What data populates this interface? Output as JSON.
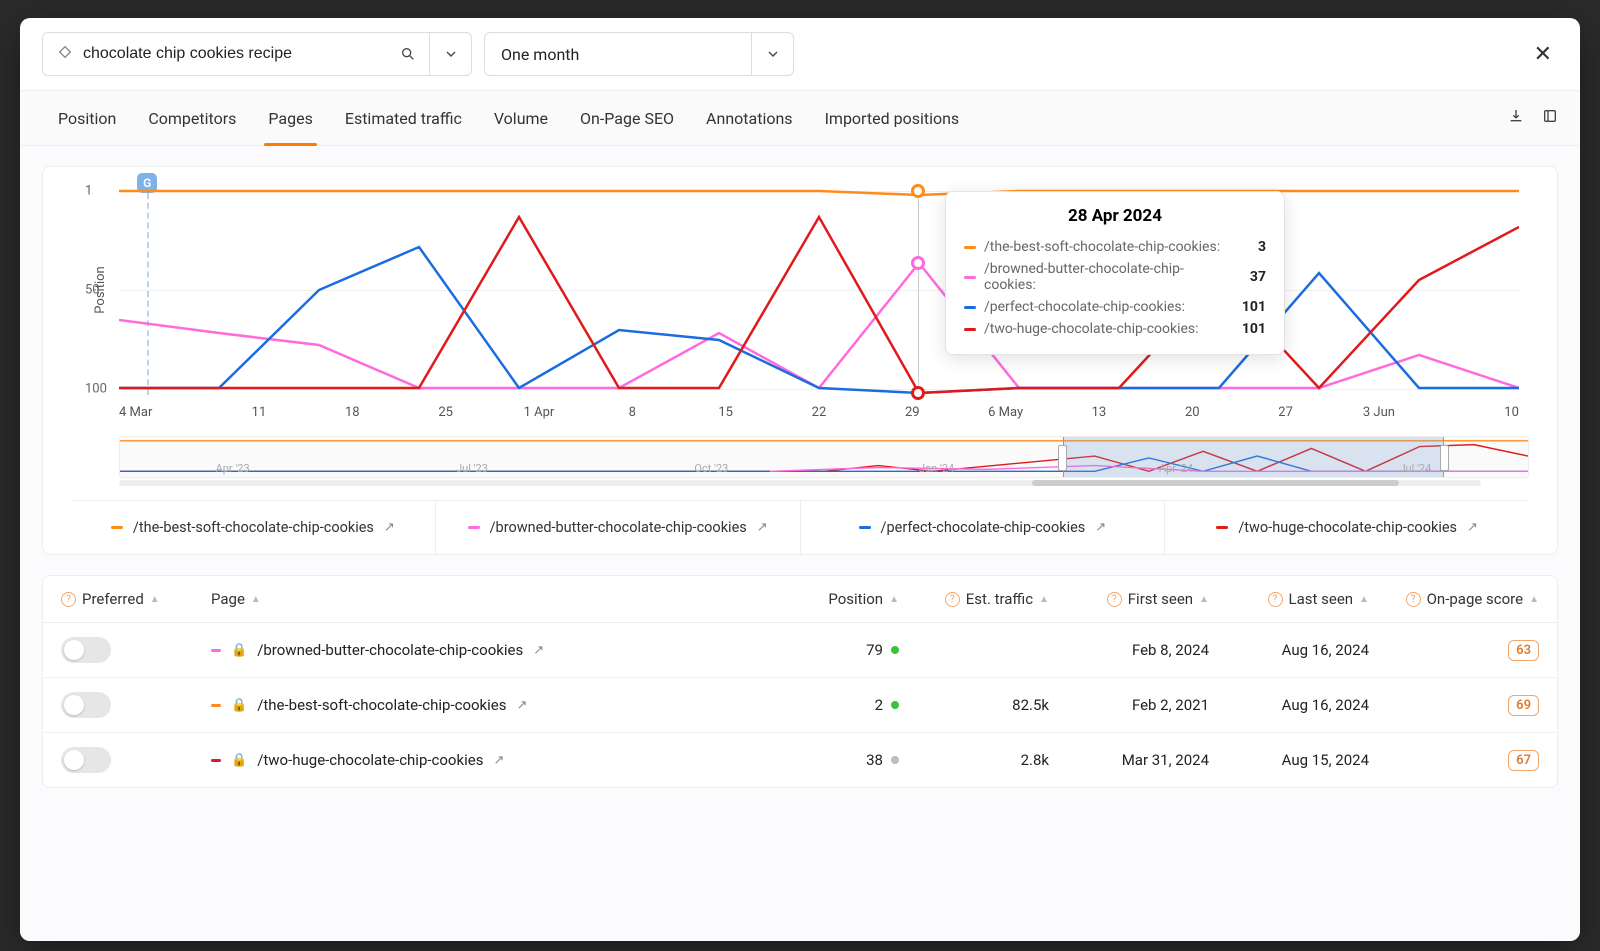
{
  "search": {
    "value": "chocolate chip cookies recipe"
  },
  "range": {
    "label": "One month"
  },
  "tabs": [
    "Position",
    "Competitors",
    "Pages",
    "Estimated traffic",
    "Volume",
    "On-Page SEO",
    "Annotations",
    "Imported positions"
  ],
  "active_tab": "Pages",
  "chart": {
    "ylabel": "Position",
    "yticks": [
      "1",
      "50",
      "100"
    ],
    "xticks": [
      "4 Mar",
      "11",
      "18",
      "25",
      "1 Apr",
      "8",
      "15",
      "22",
      "29",
      "6 May",
      "13",
      "20",
      "27",
      "3 Jun",
      "10"
    ],
    "g_marker": "G"
  },
  "tooltip": {
    "date": "28 Apr 2024",
    "rows": [
      {
        "color": "#ff8c1a",
        "label": "/the-best-soft-chocolate-chip-cookies:",
        "value": "3"
      },
      {
        "color": "#ff6adf",
        "label": "/browned-butter-chocolate-chip-cookies:",
        "value": "37"
      },
      {
        "color": "#1a6de0",
        "label": "/perfect-chocolate-chip-cookies:",
        "value": "101"
      },
      {
        "color": "#e01a1a",
        "label": "/two-huge-chocolate-chip-cookies:",
        "value": "101"
      }
    ]
  },
  "brush_ticks": [
    "Apr '23",
    "Jul '23",
    "Oct '23",
    "Jan '24",
    "Apr '24",
    "Jul '24"
  ],
  "legend": [
    {
      "color": "#ff8c1a",
      "label": "/the-best-soft-chocolate-chip-cookies"
    },
    {
      "color": "#ff6adf",
      "label": "/browned-butter-chocolate-chip-cookies"
    },
    {
      "color": "#1a6de0",
      "label": "/perfect-chocolate-chip-cookies"
    },
    {
      "color": "#e01a1a",
      "label": "/two-huge-chocolate-chip-cookies"
    }
  ],
  "table": {
    "headers": {
      "preferred": "Preferred",
      "page": "Page",
      "position": "Position",
      "traffic": "Est. traffic",
      "first": "First seen",
      "last": "Last seen",
      "score": "On-page score"
    },
    "rows": [
      {
        "color": "#ff6adf",
        "page": "/browned-butter-chocolate-chip-cookies",
        "pos": "79",
        "dot": "#3ac23a",
        "traffic": "",
        "first": "Feb 8, 2024",
        "last": "Aug 16, 2024",
        "score": "63"
      },
      {
        "color": "#ff8c1a",
        "page": "/the-best-soft-chocolate-chip-cookies",
        "pos": "2",
        "dot": "#3ac23a",
        "traffic": "82.5k",
        "first": "Feb 2, 2021",
        "last": "Aug 16, 2024",
        "score": "69"
      },
      {
        "color": "#e01a1a",
        "page": "/two-huge-chocolate-chip-cookies",
        "pos": "38",
        "dot": "#bcbcbc",
        "traffic": "2.8k",
        "first": "Mar 31, 2024",
        "last": "Aug 15, 2024",
        "score": "67"
      }
    ]
  },
  "chart_data": {
    "type": "line",
    "ylabel": "Position",
    "ylim": [
      1,
      100
    ],
    "y_inverted": true,
    "x": [
      "4 Mar",
      "11 Mar",
      "18 Mar",
      "25 Mar",
      "1 Apr",
      "8 Apr",
      "15 Apr",
      "22 Apr",
      "29 Apr",
      "6 May",
      "13 May",
      "20 May",
      "27 May",
      "3 Jun",
      "10 Jun"
    ],
    "series": [
      {
        "name": "/the-best-soft-chocolate-chip-cookies",
        "color": "#ff8c1a",
        "values": [
          1,
          1,
          1,
          1,
          1,
          1,
          1,
          1,
          3,
          1,
          1,
          1,
          1,
          1,
          1
        ]
      },
      {
        "name": "/browned-butter-chocolate-chip-cookies",
        "color": "#ff6adf",
        "values": [
          65,
          72,
          78,
          100,
          100,
          100,
          72,
          100,
          37,
          100,
          100,
          100,
          100,
          82,
          100
        ]
      },
      {
        "name": "/perfect-chocolate-chip-cookies",
        "color": "#1a6de0",
        "values": [
          100,
          100,
          50,
          30,
          100,
          70,
          75,
          100,
          101,
          100,
          100,
          100,
          42,
          100,
          100
        ]
      },
      {
        "name": "/two-huge-chocolate-chip-cookies",
        "color": "#e01a1a",
        "values": [
          100,
          100,
          100,
          100,
          15,
          100,
          100,
          15,
          101,
          100,
          100,
          45,
          100,
          45,
          20
        ]
      }
    ],
    "tooltip_point": {
      "date": "28 Apr 2024",
      "values": {
        "the-best": 3,
        "browned": 37,
        "perfect": 101,
        "two-huge": 101
      }
    }
  }
}
